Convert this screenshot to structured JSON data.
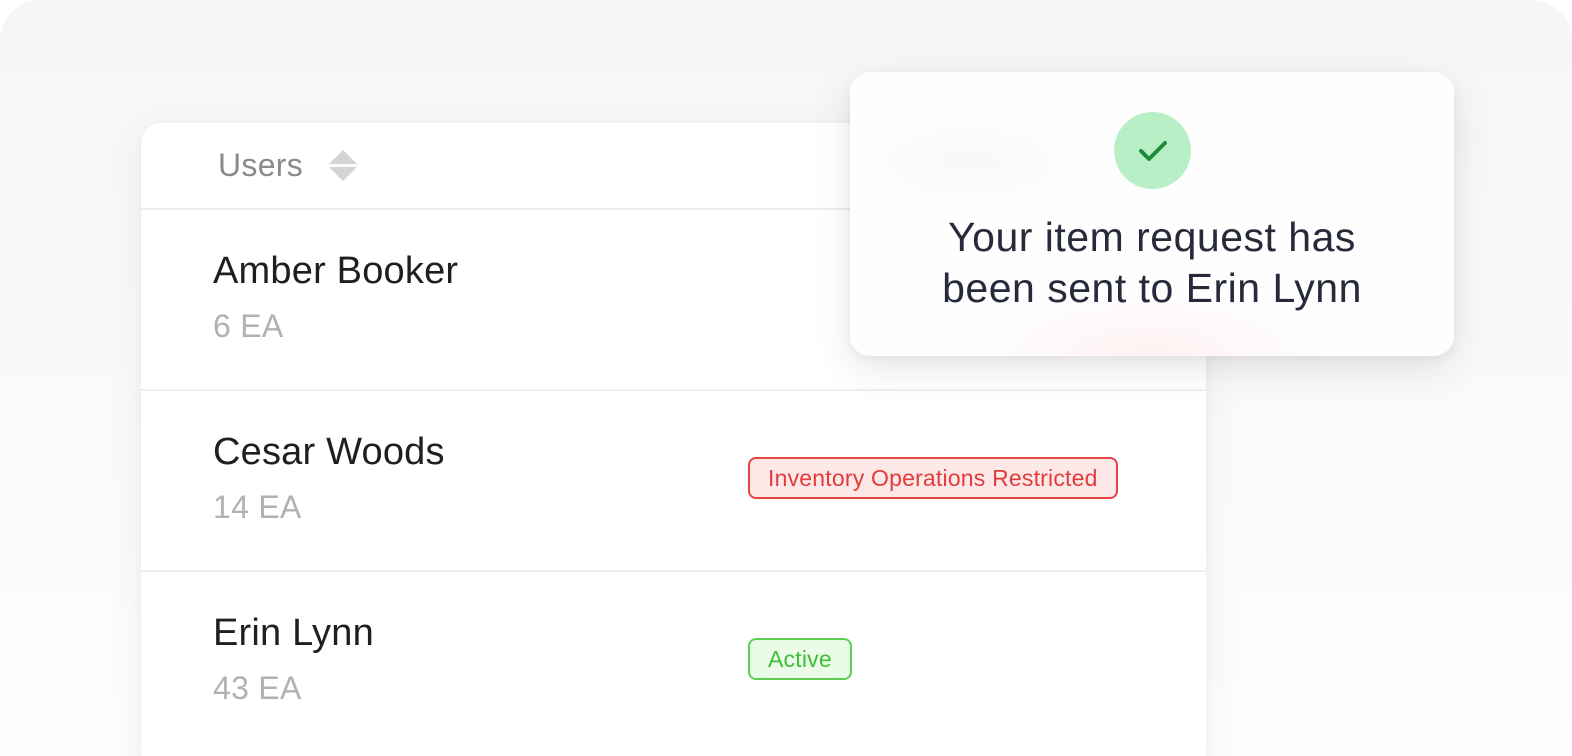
{
  "table": {
    "header": {
      "label": "Users"
    },
    "rows": [
      {
        "name": "Amber Booker",
        "quantity": "6 EA",
        "badge": null
      },
      {
        "name": "Cesar Woods",
        "quantity": "14 EA",
        "badge": {
          "label": "Inventory Operations Restricted",
          "status": "restricted",
          "color": "#e33b3b"
        }
      },
      {
        "name": "Erin Lynn",
        "quantity": "43 EA",
        "badge": {
          "label": "Active",
          "status": "active",
          "color": "#3fbf38"
        }
      }
    ]
  },
  "toast": {
    "icon": "check-icon",
    "line1": "Your item request has",
    "line2": "been sent to Erin Lynn",
    "accent_color": "#b8efc7",
    "icon_color": "#1f8a3c"
  }
}
